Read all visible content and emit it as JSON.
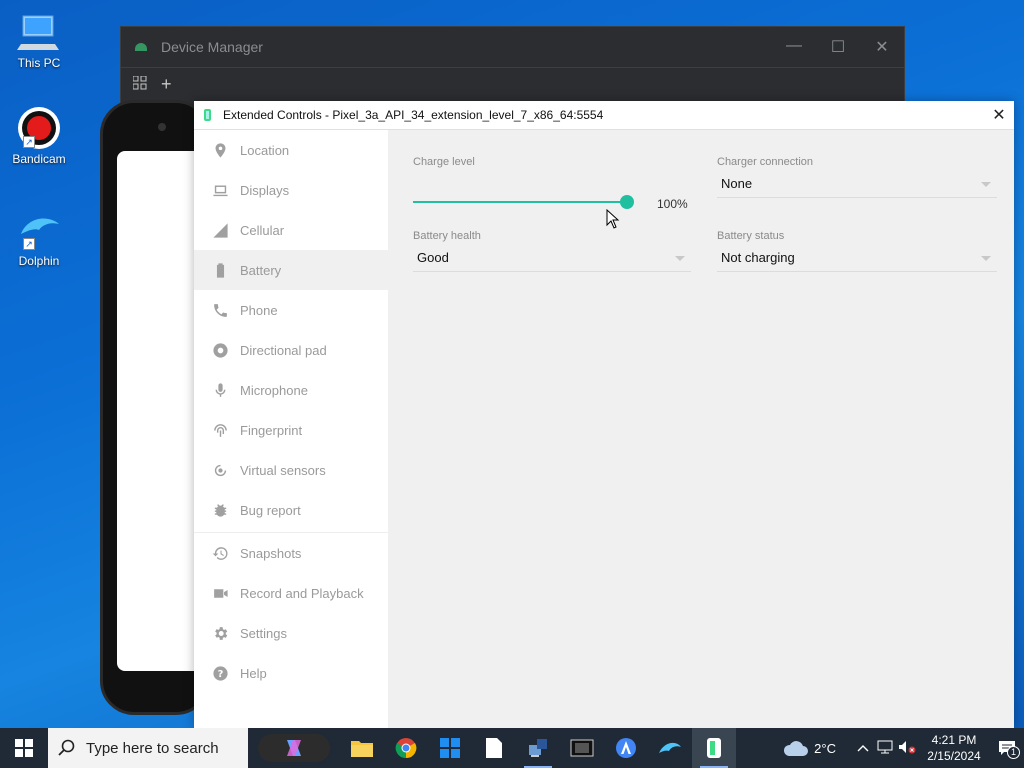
{
  "desktop": {
    "icons": [
      {
        "label": "This PC"
      },
      {
        "label": "Bandicam"
      },
      {
        "label": "Dolphin"
      }
    ]
  },
  "device_manager": {
    "title": "Device Manager",
    "minimize": "—",
    "maximize": "☐",
    "close": "✕",
    "add": "+"
  },
  "extended_controls": {
    "title": "Extended Controls - Pixel_3a_API_34_extension_level_7_x86_64:5554",
    "close": "✕",
    "nav": [
      {
        "label": "Location",
        "icon": "location-icon"
      },
      {
        "label": "Displays",
        "icon": "display-icon"
      },
      {
        "label": "Cellular",
        "icon": "cellular-icon"
      },
      {
        "label": "Battery",
        "icon": "battery-icon",
        "active": true
      },
      {
        "label": "Phone",
        "icon": "phone-icon"
      },
      {
        "label": "Directional pad",
        "icon": "dpad-icon"
      },
      {
        "label": "Microphone",
        "icon": "microphone-icon"
      },
      {
        "label": "Fingerprint",
        "icon": "fingerprint-icon"
      },
      {
        "label": "Virtual sensors",
        "icon": "sensors-icon"
      },
      {
        "label": "Bug report",
        "icon": "bug-icon"
      },
      {
        "label": "Snapshots",
        "icon": "history-icon"
      },
      {
        "label": "Record and Playback",
        "icon": "video-icon"
      },
      {
        "label": "Settings",
        "icon": "gear-icon"
      },
      {
        "label": "Help",
        "icon": "help-icon"
      }
    ],
    "battery": {
      "charge_level_label": "Charge level",
      "charge_level_value": "100%",
      "charge_fraction": 1.0,
      "charger_connection_label": "Charger connection",
      "charger_connection_value": "None",
      "battery_health_label": "Battery health",
      "battery_health_value": "Good",
      "battery_status_label": "Battery status",
      "battery_status_value": "Not charging"
    },
    "accent_color": "#1fbf9f"
  },
  "taskbar": {
    "search_placeholder": "Type here to search",
    "weather": "2°C",
    "time": "4:21 PM",
    "date": "2/15/2024",
    "notifications": "1"
  }
}
